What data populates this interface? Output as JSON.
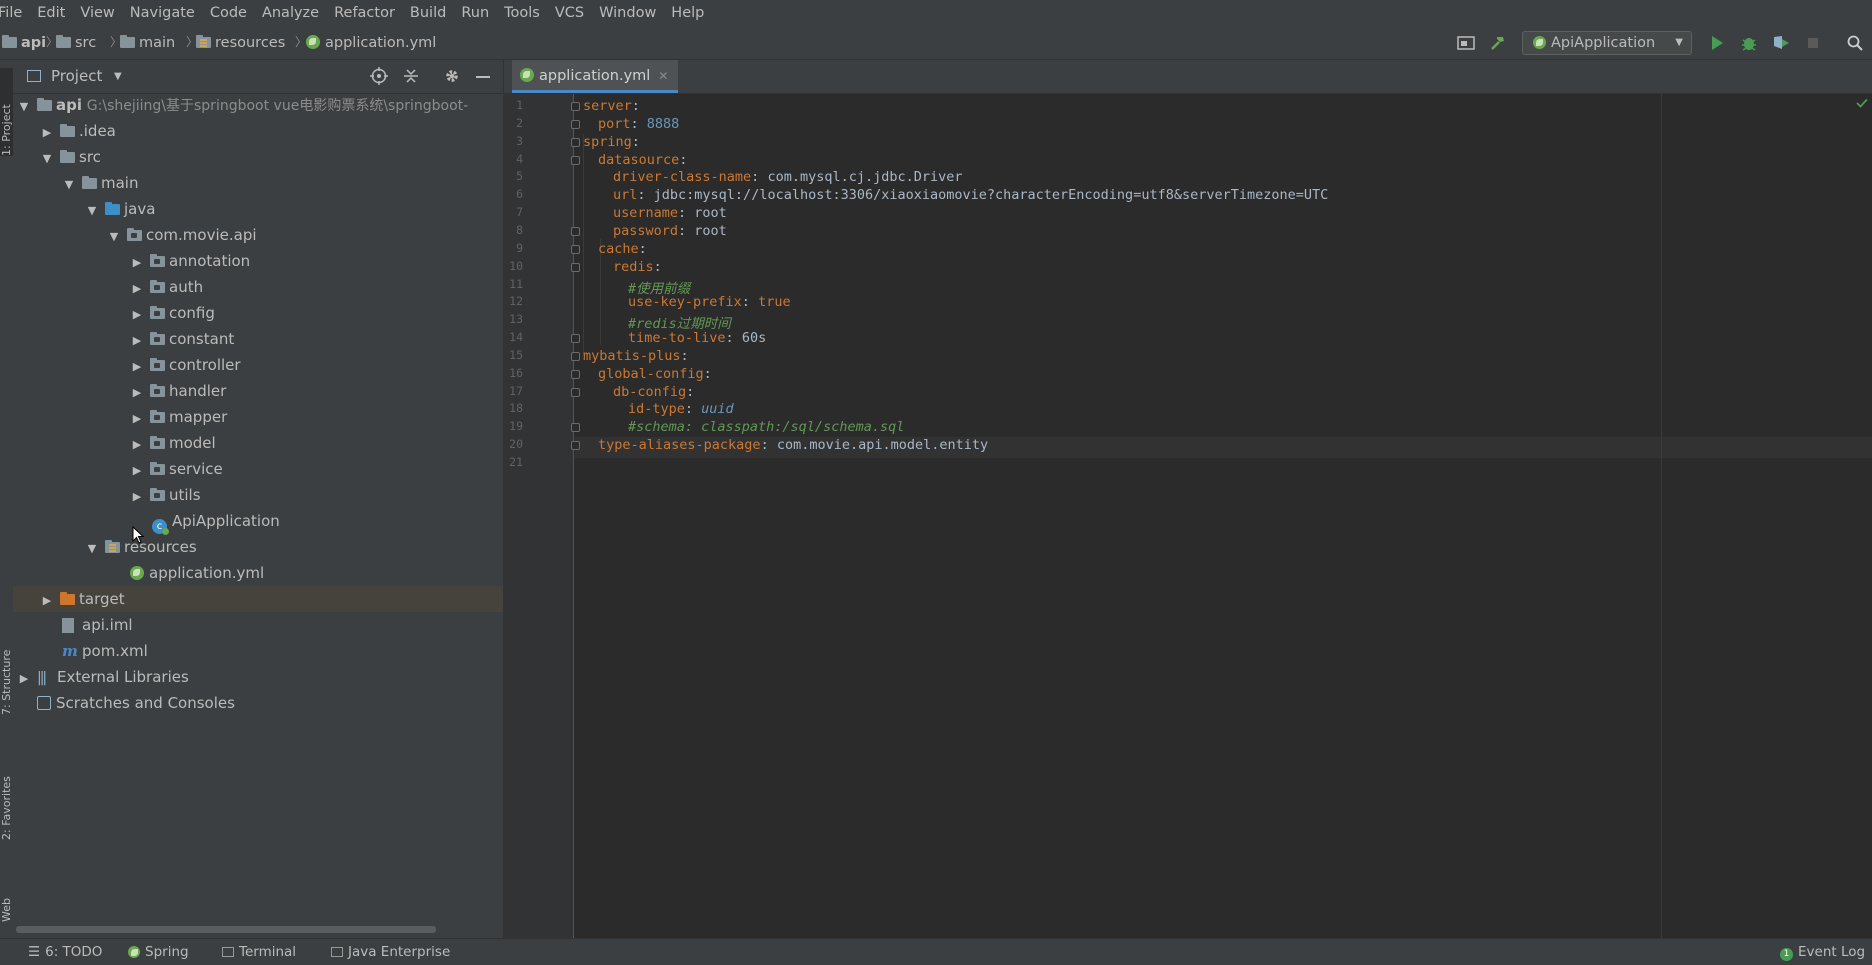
{
  "menu": [
    "File",
    "Edit",
    "View",
    "Navigate",
    "Code",
    "Analyze",
    "Refactor",
    "Build",
    "Run",
    "Tools",
    "VCS",
    "Window",
    "Help"
  ],
  "breadcrumbs": [
    "api",
    "src",
    "main",
    "resources",
    "application.yml"
  ],
  "run_config": "ApiApplication",
  "project_panel": {
    "title": "Project",
    "root_name": "api",
    "root_path": "G:\\shejiing\\基于springboot vue电影购票系统\\springboot-"
  },
  "tree": [
    {
      "label": "api"
    },
    {
      "label": ".idea"
    },
    {
      "label": "src"
    },
    {
      "label": "main"
    },
    {
      "label": "java"
    },
    {
      "label": "com.movie.api"
    },
    {
      "label": "annotation"
    },
    {
      "label": "auth"
    },
    {
      "label": "config"
    },
    {
      "label": "constant"
    },
    {
      "label": "controller"
    },
    {
      "label": "handler"
    },
    {
      "label": "mapper"
    },
    {
      "label": "model"
    },
    {
      "label": "service"
    },
    {
      "label": "utils"
    },
    {
      "label": "ApiApplication"
    },
    {
      "label": "resources"
    },
    {
      "label": "application.yml"
    },
    {
      "label": "target"
    },
    {
      "label": "api.iml"
    },
    {
      "label": "pom.xml"
    },
    {
      "label": "External Libraries"
    },
    {
      "label": "Scratches and Consoles"
    }
  ],
  "side_tabs": [
    "1: Project",
    "7: Structure",
    "2: Favorites",
    "Web"
  ],
  "editor_tab": "application.yml",
  "code_lines": [
    {
      "n": "1",
      "key": "server",
      "val": ""
    },
    {
      "n": "2",
      "key": "port",
      "val": "8888"
    },
    {
      "n": "3",
      "key": "spring",
      "val": ""
    },
    {
      "n": "4",
      "key": "datasource",
      "val": ""
    },
    {
      "n": "5",
      "key": "driver-class-name",
      "val": "com.mysql.cj.jdbc.Driver"
    },
    {
      "n": "6",
      "key": "url",
      "val": "jdbc:mysql://localhost:3306/xiaoxiaomovie?characterEncoding=utf8&serverTimezone=UTC"
    },
    {
      "n": "7",
      "key": "username",
      "val": "root"
    },
    {
      "n": "8",
      "key": "password",
      "val": "root"
    },
    {
      "n": "9",
      "key": "cache",
      "val": ""
    },
    {
      "n": "10",
      "key": "redis",
      "val": ""
    },
    {
      "n": "11",
      "comment": "#使用前缀"
    },
    {
      "n": "12",
      "key": "use-key-prefix",
      "val": "true"
    },
    {
      "n": "13",
      "comment": "#redis过期时间"
    },
    {
      "n": "14",
      "key": "time-to-live",
      "val": "60s"
    },
    {
      "n": "15",
      "key": "mybatis-plus",
      "val": ""
    },
    {
      "n": "16",
      "key": "global-config",
      "val": ""
    },
    {
      "n": "17",
      "key": "db-config",
      "val": ""
    },
    {
      "n": "18",
      "key": "id-type",
      "val": "uuid"
    },
    {
      "n": "19",
      "comment": "#schema: classpath:/sql/schema.sql"
    },
    {
      "n": "20",
      "key": "type-aliases-package",
      "val": "com.movie.api.model.entity"
    },
    {
      "n": "21",
      "key": "",
      "val": ""
    }
  ],
  "bottom_tabs": [
    "6: TODO",
    "Spring",
    "Terminal",
    "Java Enterprise"
  ],
  "event_log": {
    "label": "Event Log",
    "count": "1"
  },
  "colors": {
    "key": "#cc7832",
    "string": "#a9b7c6",
    "number": "#6897bb",
    "comment": "#629755",
    "selection": "#4a88c7"
  }
}
